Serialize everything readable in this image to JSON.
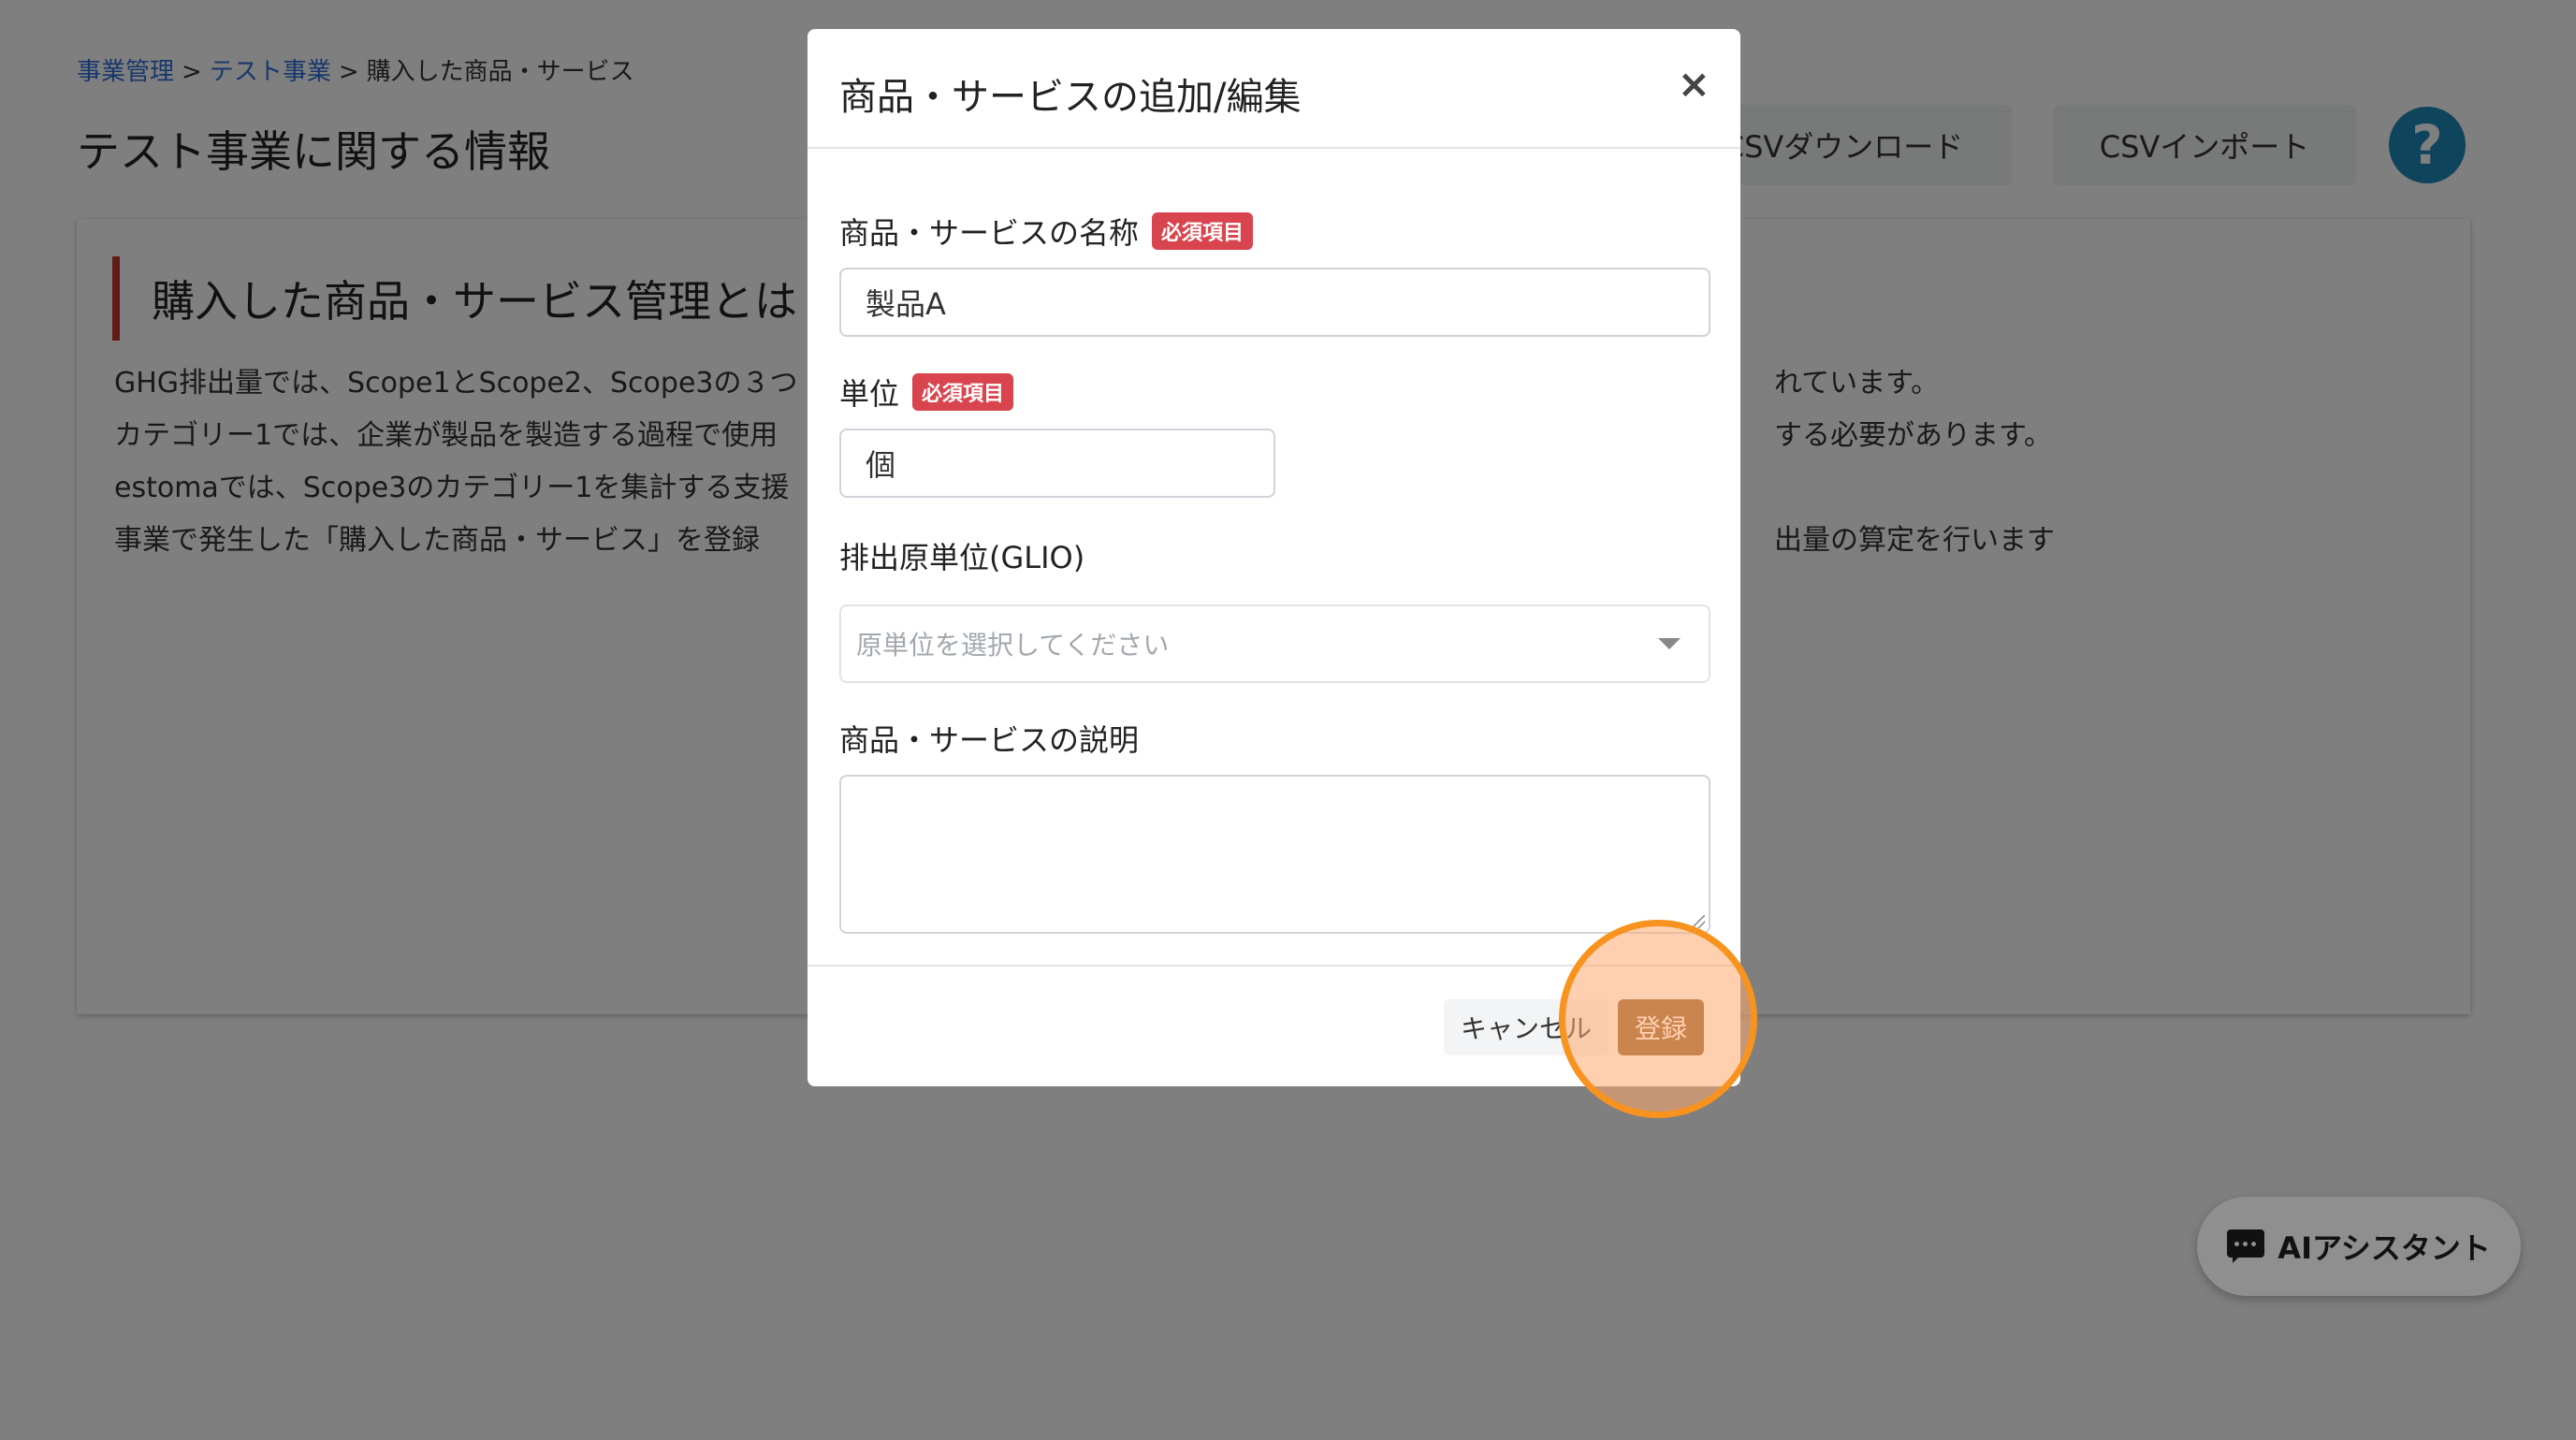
{
  "breadcrumb": {
    "item1": "事業管理",
    "sep": ">",
    "item2": "テスト事業",
    "item3": "購入した商品・サービス"
  },
  "page_title": "テスト事業に関する情報",
  "toolbar": {
    "csv_download": "CSVダウンロード",
    "csv_import": "CSVインポート",
    "help": "?"
  },
  "card": {
    "title": "購入した商品・サービス管理とは",
    "lines": [
      "GHG排出量では、Scope1とScope2、Scope3の３つ",
      "カテゴリー1では、企業が製品を製造する過程で使用",
      "estomaでは、Scope3のカテゴリー1を集計する支援",
      "事業で発生した「購入した商品・サービス」を登録"
    ],
    "lines_right": [
      "れています。",
      "する必要があります。",
      "",
      "出量の算定を行います"
    ]
  },
  "modal": {
    "title": "商品・サービスの追加/編集",
    "close": "×",
    "name_label": "商品・サービスの名称",
    "required_badge": "必須項目",
    "name_value": "製品A",
    "unit_label": "単位",
    "unit_value": "個",
    "factor_label": "排出原単位(GLIO)",
    "factor_placeholder": "原単位を選択してください",
    "desc_label": "商品・サービスの説明",
    "desc_value": "",
    "cancel": "キャンセル",
    "submit": "登録"
  },
  "assistant": {
    "label": "AIアシスタント"
  },
  "colors": {
    "accent": "#c0392b",
    "primary": "#1f8bb8",
    "submit": "#8b5a2b",
    "highlight": "#f7931e",
    "badge": "#d9454f"
  }
}
